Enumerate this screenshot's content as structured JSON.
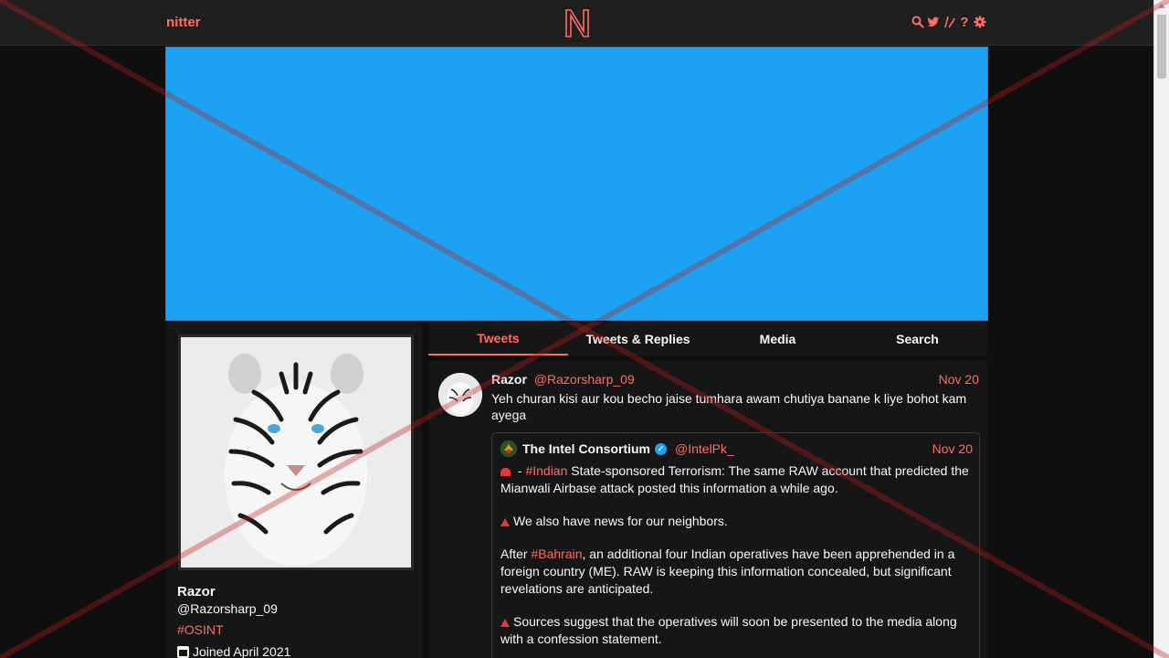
{
  "nav": {
    "brand": "nitter",
    "logo_letter": "N",
    "icons": [
      "search-icon",
      "twitter-bird-icon",
      "rss-icon",
      "help-icon",
      "settings-gear-icon"
    ]
  },
  "colors": {
    "accent": "#ff6c60",
    "banner": "#1da1f2",
    "background": "#0f0f0f",
    "panel": "#161616"
  },
  "profile": {
    "fullname": "Razor",
    "username": "@Razorsharp_09",
    "bio": "#OSINT",
    "joined": "Joined April 2021"
  },
  "tabs": [
    {
      "label": "Tweets",
      "active": true
    },
    {
      "label": "Tweets & Replies",
      "active": false
    },
    {
      "label": "Media",
      "active": false
    },
    {
      "label": "Search",
      "active": false
    }
  ],
  "tweet": {
    "name": "Razor",
    "handle": "@Razorsharp_09",
    "date": "Nov 20",
    "text": "Yeh churan kisi aur kou becho jaise tumhara awam chutiya banane k liye bohot kam ayega",
    "quote": {
      "name": "The Intel Consortium",
      "verified": true,
      "handle": "@IntelPk_",
      "date": "Nov 20",
      "p1_pre": " - ",
      "p1_tag": "#Indian",
      "p1_post": " State-sponsored Terrorism: The same RAW account that predicted the Mianwali Airbase attack posted this information a while ago.",
      "p2": "We also have news for our neighbors.",
      "p3_pre": "After ",
      "p3_tag": "#Bahrain",
      "p3_post": ", an additional four Indian operatives have been apprehended in a foreign country (ME). RAW is keeping this information concealed, but significant revelations are anticipated.",
      "p4": "Sources suggest that the operatives will soon be presented to the media along with a confession statement."
    }
  }
}
